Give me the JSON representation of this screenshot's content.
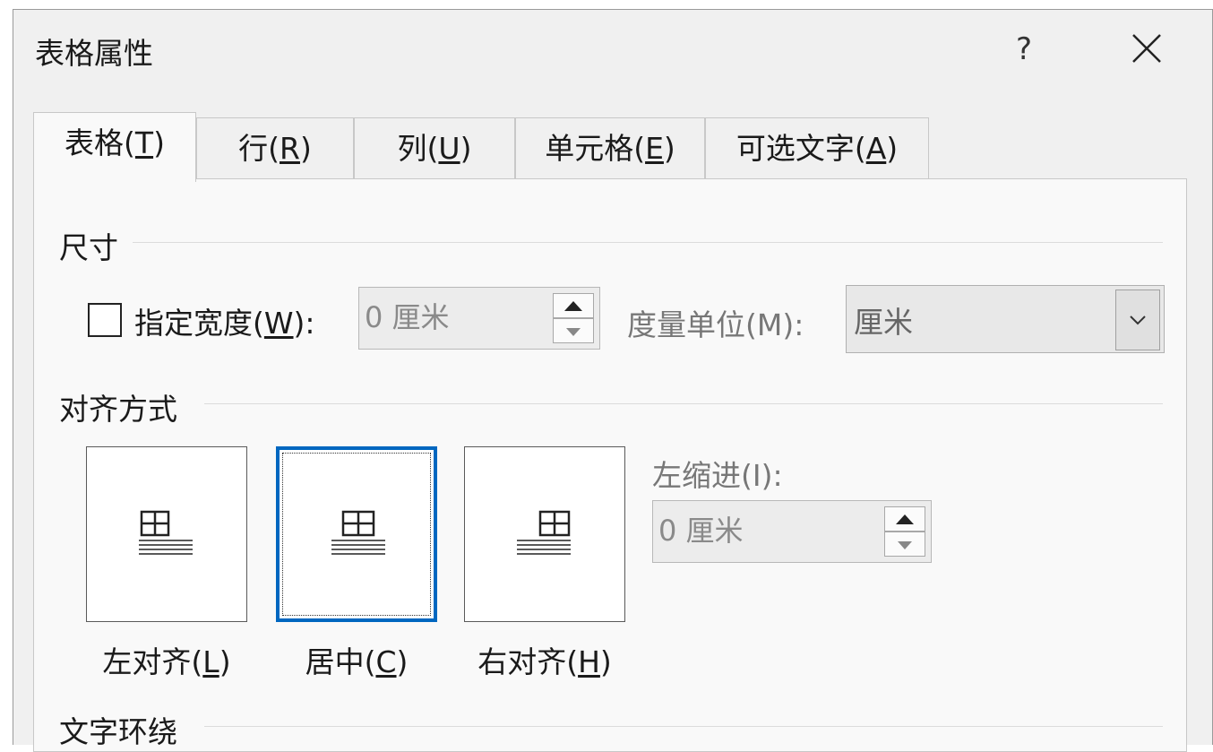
{
  "window": {
    "title": "表格属性",
    "help_label": "?"
  },
  "tabs": [
    {
      "label_pre": "表格(",
      "mnemonic": "T",
      "label_post": ")",
      "active": true
    },
    {
      "label_pre": "行(",
      "mnemonic": "R",
      "label_post": ")",
      "active": false
    },
    {
      "label_pre": "列(",
      "mnemonic": "U",
      "label_post": ")",
      "active": false
    },
    {
      "label_pre": "单元格(",
      "mnemonic": "E",
      "label_post": ")",
      "active": false
    },
    {
      "label_pre": "可选文字(",
      "mnemonic": "A",
      "label_post": ")",
      "active": false
    }
  ],
  "size_section": {
    "title": "尺寸",
    "specify_width": {
      "label_pre": "指定宽度(",
      "mnemonic": "W",
      "label_post": "):",
      "checked": false
    },
    "width_value": "0 厘米",
    "measure_label": "度量单位(M):",
    "measure_value": "厘米"
  },
  "alignment_section": {
    "title": "对齐方式",
    "options": [
      {
        "label_pre": "左对齐(",
        "mnemonic": "L",
        "label_post": ")",
        "selected": false
      },
      {
        "label_pre": "居中(",
        "mnemonic": "C",
        "label_post": ")",
        "selected": true
      },
      {
        "label_pre": "右对齐(",
        "mnemonic": "H",
        "label_post": ")",
        "selected": false
      }
    ],
    "indent_label": "左缩进(I):",
    "indent_value": "0 厘米"
  },
  "wrap_section": {
    "title": "文字环绕"
  },
  "colors": {
    "dialog_bg": "#f0f0f0",
    "panel_bg": "#f9f9f9",
    "selection_accent": "#0067c0"
  },
  "icons": [
    "close-icon",
    "spin-up-icon",
    "spin-down-icon",
    "chevron-down-icon",
    "table-align-left-icon",
    "table-align-center-icon",
    "table-align-right-icon"
  ]
}
